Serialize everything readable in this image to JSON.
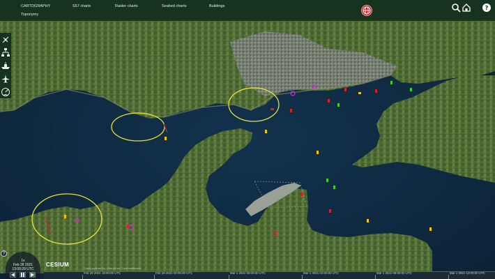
{
  "menu": {
    "items": [
      {
        "label": "CARTOGRAPHY"
      },
      {
        "label": "S57 charts"
      },
      {
        "label": "Raster charts"
      },
      {
        "label": "Seabed charts"
      },
      {
        "label": "Buildings"
      },
      {
        "label": "Toponymy"
      }
    ]
  },
  "header_icons": [
    "globe-icon",
    "search-icon",
    "home-icon",
    "help-icon"
  ],
  "toolbar": {
    "icons": [
      "satellite-icon",
      "hierarchy-icon",
      "ship-layer-icon",
      "aircraft-icon",
      "radar-icon"
    ]
  },
  "animation": {
    "speed": "1x",
    "date": "Feb 28 2021",
    "time": "13:00:29 UTC"
  },
  "credits": {
    "brand": "CESIUM",
    "text": "Data provided by Cesium ion. Click attribution"
  },
  "timeline": {
    "labels": [
      "Feb 28 2021 18:00:00 UTC",
      "Feb 28 2021 00:00:00 UTC",
      "Mar 1 2021 00:00:00 UTC",
      "Mar 1 2021 04:00:00 UTC",
      "Mar 1 2021 08:00:00 UTC",
      "Mar 1 2021 12:00:00 UTC"
    ]
  },
  "colors": {
    "header": "#15331f",
    "sea": "#0f2a40",
    "range_ring": "#e8e03a",
    "buoy_red": "#d3242a",
    "buoy_green": "#3fcf2c",
    "cardinal": "#f3c21b",
    "zone_magenta": "#d62ad9"
  }
}
